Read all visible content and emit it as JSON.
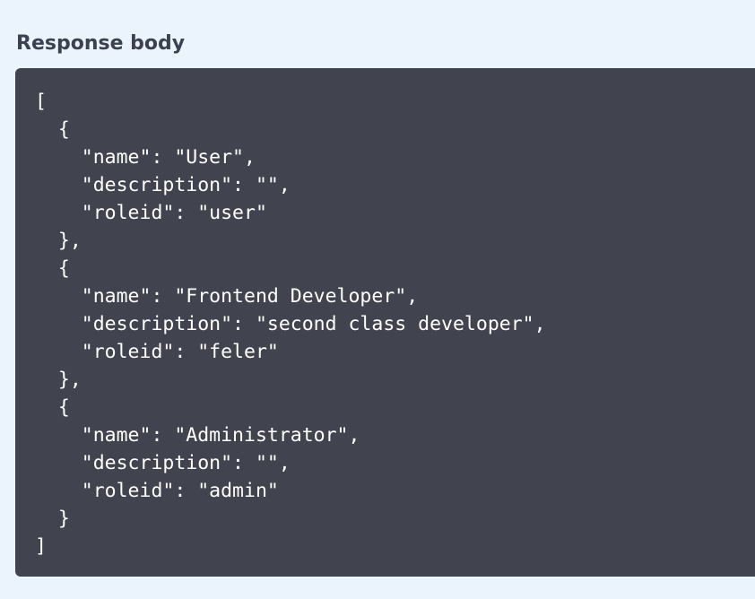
{
  "response": {
    "title": "Response body",
    "body": "[\n  {\n    \"name\": \"User\",\n    \"description\": \"\",\n    \"roleid\": \"user\"\n  },\n  {\n    \"name\": \"Frontend Developer\",\n    \"description\": \"second class developer\",\n    \"roleid\": \"feler\"\n  },\n  {\n    \"name\": \"Administrator\",\n    \"description\": \"\",\n    \"roleid\": \"admin\"\n  }\n]"
  },
  "colors": {
    "page_background": "#ebf3fc",
    "title_text": "#3b4151",
    "code_background": "#41444e",
    "code_text": "#ffffff"
  }
}
